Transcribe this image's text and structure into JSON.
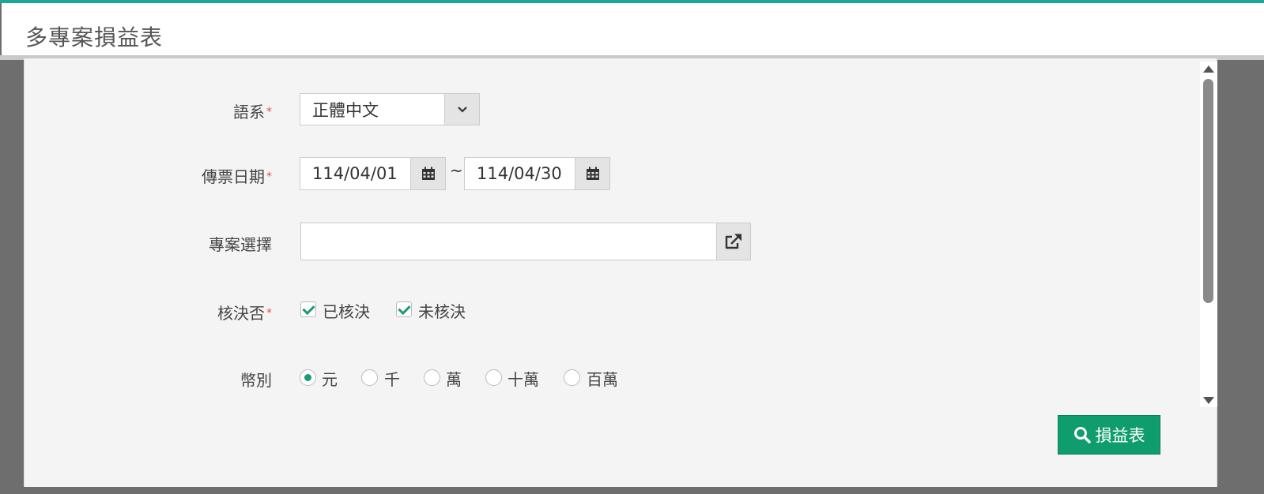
{
  "header": {
    "title": "多專案損益表"
  },
  "form": {
    "language": {
      "label": "語系",
      "required_mark": "*",
      "value": "正體中文"
    },
    "voucher_date": {
      "label": "傳票日期",
      "required_mark": "*",
      "from": "114/04/01",
      "separator": "~",
      "to": "114/04/30"
    },
    "project": {
      "label": "專案選擇",
      "value": ""
    },
    "approval": {
      "label": "核決否",
      "required_mark": "*",
      "options": [
        {
          "label": "已核決",
          "checked": true
        },
        {
          "label": "未核決",
          "checked": true
        }
      ]
    },
    "currency_unit": {
      "label": "幣別",
      "options": [
        {
          "label": "元",
          "selected": true
        },
        {
          "label": "千",
          "selected": false
        },
        {
          "label": "萬",
          "selected": false
        },
        {
          "label": "十萬",
          "selected": false
        },
        {
          "label": "百萬",
          "selected": false
        }
      ]
    }
  },
  "actions": {
    "submit_label": "損益表"
  },
  "icons": {
    "dropdown": "chevron-down-icon",
    "date_picker": "calendar-icon",
    "project_picker": "external-link-icon",
    "submit": "search-icon"
  },
  "colors": {
    "accent": "#1fa891",
    "button": "#0f9d6e",
    "check": "#1a9b78",
    "required": "#d9534f"
  }
}
